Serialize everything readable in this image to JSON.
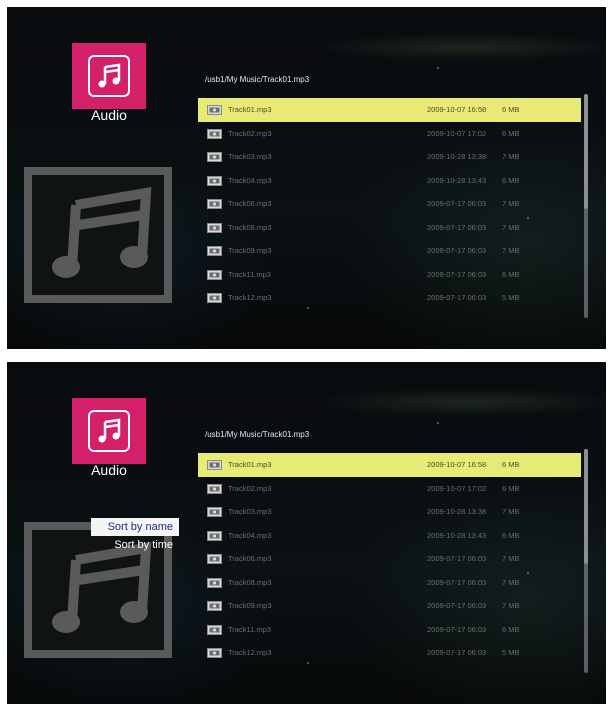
{
  "app": {
    "label": "Audio",
    "icon": "music-note-icon"
  },
  "path": "/usb1/My Music/Track01.mp3",
  "files": [
    {
      "name": "Track01.mp3",
      "date": "2009-10-07 16:58",
      "size": "6 MB",
      "selected": true
    },
    {
      "name": "Track02.mp3",
      "date": "2009-10-07 17:02",
      "size": "6 MB"
    },
    {
      "name": "Track03.mp3",
      "date": "2009-10-28 13:38",
      "size": "7 MB"
    },
    {
      "name": "Track04.mp3",
      "date": "2009-10-28 13:43",
      "size": "6 MB"
    },
    {
      "name": "Track06.mp3",
      "date": "2009-07-17 06:03",
      "size": "7 MB"
    },
    {
      "name": "Track08.mp3",
      "date": "2009-07-17 06:03",
      "size": "7 MB"
    },
    {
      "name": "Track09.mp3",
      "date": "2009-07-17 06:03",
      "size": "7 MB"
    },
    {
      "name": "Track11.mp3",
      "date": "2009-07-17 06:03",
      "size": "6 MB"
    },
    {
      "name": "Track12.mp3",
      "date": "2009-07-17 06:03",
      "size": "5 MB"
    }
  ],
  "sort_menu": {
    "items": [
      "Sort by name",
      "Sort by time"
    ],
    "active": "Sort by name"
  },
  "colors": {
    "accent": "#d41f6a",
    "selection": "#e7ea74",
    "menu_text_active": "#1c2e8a"
  }
}
